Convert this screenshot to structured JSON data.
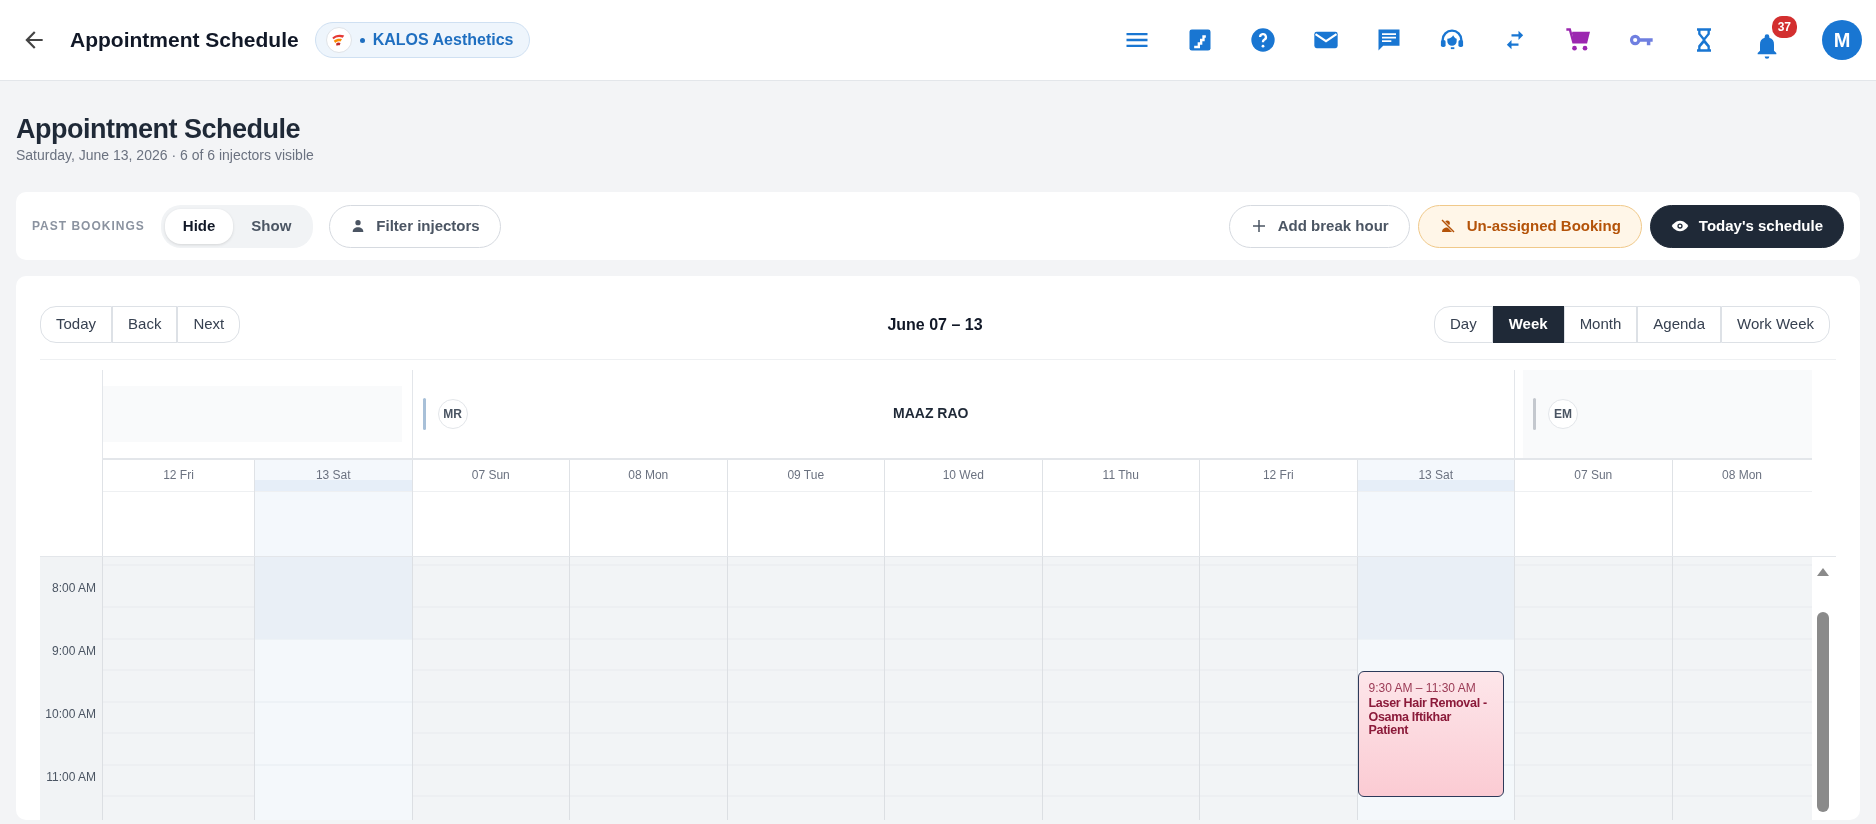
{
  "app_bar": {
    "title": "Appointment Schedule",
    "clinic": "KALOS Aesthetics",
    "notifications": "37",
    "avatar": "M"
  },
  "page": {
    "title": "Appointment Schedule",
    "subtitle": "Saturday, June 13, 2026 · 6 of 6 injectors visible"
  },
  "filters": {
    "label": "PAST BOOKINGS",
    "options": [
      {
        "label": "Hide",
        "selected": true
      },
      {
        "label": "Show",
        "selected": false
      }
    ],
    "filter_button": "Filter injectors",
    "actions": [
      {
        "kind": "break",
        "label": "Add break hour"
      },
      {
        "kind": "unassigned",
        "label": "Un-assigned Booking"
      },
      {
        "kind": "today",
        "label": "Today's schedule"
      }
    ]
  },
  "calendar": {
    "nav": [
      "Today",
      "Back",
      "Next"
    ],
    "range": "June 07 – 13",
    "views": [
      {
        "label": "Day",
        "selected": false
      },
      {
        "label": "Week",
        "selected": true
      },
      {
        "label": "Month",
        "selected": false
      },
      {
        "label": "Agenda",
        "selected": false
      },
      {
        "label": "Work Week",
        "selected": false
      }
    ],
    "times": [
      "8:00 AM",
      "9:00 AM",
      "10:00 AM",
      "11:00 AM"
    ],
    "resources": [
      {
        "days": [
          {
            "label": "12 Fri",
            "today": false
          },
          {
            "label": "13 Sat",
            "today": true
          }
        ]
      },
      {
        "initials": "MR",
        "name": "MAAZ RAO",
        "days": [
          {
            "label": "07 Sun",
            "today": false
          },
          {
            "label": "08 Mon",
            "today": false
          },
          {
            "label": "09 Tue",
            "today": false
          },
          {
            "label": "10 Wed",
            "today": false
          },
          {
            "label": "11 Thu",
            "today": false
          },
          {
            "label": "12 Fri",
            "today": false
          },
          {
            "label": "13 Sat",
            "today": true,
            "events": [
              {
                "time": "9:30 AM – 11:30 AM",
                "title": "Laser Hair Removal - Osama Iftikhar Patient"
              }
            ]
          }
        ]
      },
      {
        "initials": "EM",
        "days": [
          {
            "label": "07 Sun",
            "today": false
          },
          {
            "label": "08 Mon",
            "today": false
          }
        ]
      }
    ]
  }
}
